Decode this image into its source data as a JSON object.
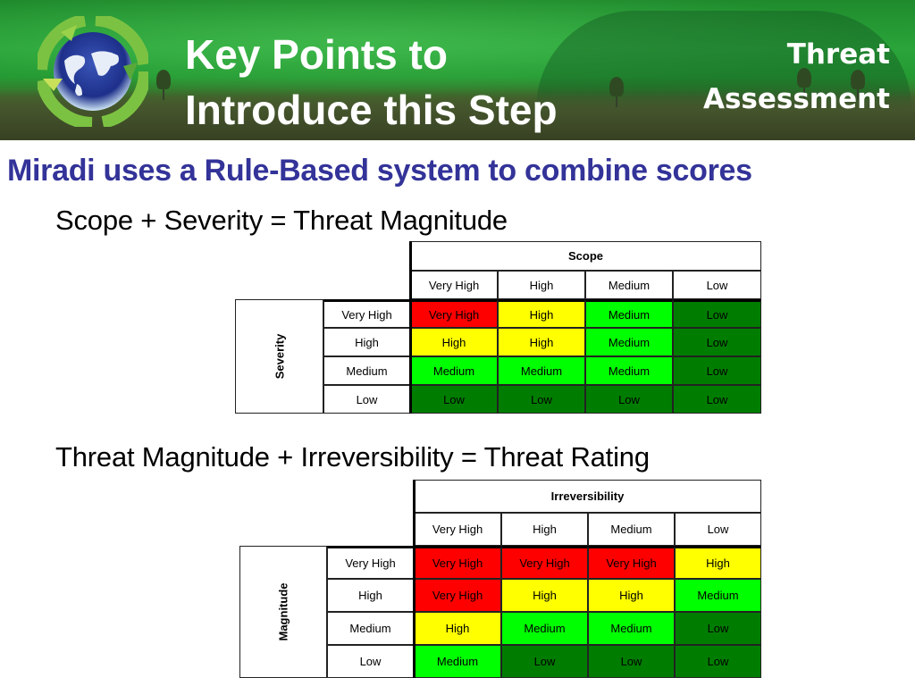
{
  "banner": {
    "title_line1": "Key Points to",
    "title_line2": "Introduce this Step",
    "section_line1": "Threat",
    "section_line2": "Assessment",
    "logo_icon": "recycle-globe-icon"
  },
  "headline": "Miradi uses a Rule-Based system to combine scores",
  "colors": {
    "headline": "#333399",
    "very_high": "#ff0000",
    "high": "#ffff00",
    "medium": "#00ff00",
    "low": "#007d00"
  },
  "matrix1": {
    "equation": "Scope + Severity = Threat Magnitude",
    "column_axis": "Scope",
    "row_axis": "Severity",
    "columns": [
      "Very High",
      "High",
      "Medium",
      "Low"
    ],
    "rows": [
      {
        "label": "Very High",
        "cells": [
          "Very High",
          "High",
          "Medium",
          "Low"
        ]
      },
      {
        "label": "High",
        "cells": [
          "High",
          "High",
          "Medium",
          "Low"
        ]
      },
      {
        "label": "Medium",
        "cells": [
          "Medium",
          "Medium",
          "Medium",
          "Low"
        ]
      },
      {
        "label": "Low",
        "cells": [
          "Low",
          "Low",
          "Low",
          "Low"
        ]
      }
    ]
  },
  "matrix2": {
    "equation": "Threat Magnitude + Irreversibility = Threat Rating",
    "column_axis": "Irreversibility",
    "row_axis": "Magnitude",
    "columns": [
      "Very High",
      "High",
      "Medium",
      "Low"
    ],
    "rows": [
      {
        "label": "Very High",
        "cells": [
          "Very High",
          "Very High",
          "Very High",
          "High"
        ]
      },
      {
        "label": "High",
        "cells": [
          "Very High",
          "High",
          "High",
          "Medium"
        ]
      },
      {
        "label": "Medium",
        "cells": [
          "High",
          "Medium",
          "Medium",
          "Low"
        ]
      },
      {
        "label": "Low",
        "cells": [
          "Medium",
          "Low",
          "Low",
          "Low"
        ]
      }
    ]
  }
}
